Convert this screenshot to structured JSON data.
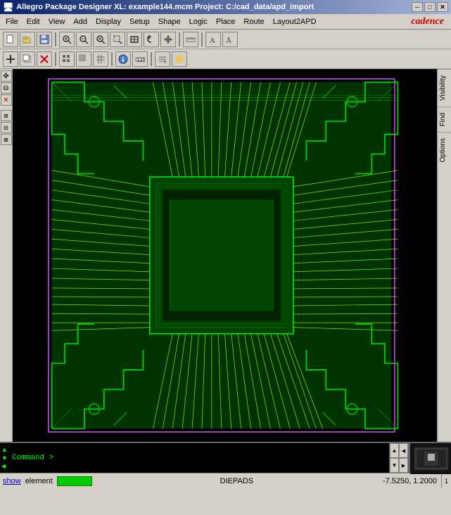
{
  "titleBar": {
    "title": "Allegro Package Designer XL: example144.mcm  Project: C:/cad_data/apd_import",
    "minBtn": "─",
    "maxBtn": "□",
    "closeBtn": "✕"
  },
  "menuBar": {
    "items": [
      "File",
      "Edit",
      "View",
      "Add",
      "Display",
      "Setup",
      "Shape",
      "Logic",
      "Place",
      "Route",
      "Layout2APD"
    ],
    "logo": "cadence"
  },
  "toolbar1": {
    "buttons": [
      {
        "name": "new",
        "icon": "📄"
      },
      {
        "name": "open",
        "icon": "📂"
      },
      {
        "name": "save",
        "icon": "💾"
      },
      {
        "name": "sep1",
        "sep": true
      },
      {
        "name": "zoom-in-center",
        "icon": "⊕"
      },
      {
        "name": "zoom-out",
        "icon": "🔍"
      },
      {
        "name": "zoom-in",
        "icon": "🔎"
      },
      {
        "name": "zoom-area",
        "icon": "🔍"
      },
      {
        "name": "zoom-fit",
        "icon": "↔"
      },
      {
        "name": "zoom-prev",
        "icon": "↺"
      },
      {
        "name": "pan",
        "icon": "✋"
      },
      {
        "name": "sep2",
        "sep": true
      },
      {
        "name": "ruler",
        "icon": "📏"
      },
      {
        "name": "sep3",
        "sep": true
      },
      {
        "name": "text1",
        "icon": "A"
      },
      {
        "name": "text2",
        "icon": "Ā"
      }
    ]
  },
  "toolbar2": {
    "buttons": [
      {
        "name": "select",
        "icon": "✜"
      },
      {
        "name": "copy",
        "icon": "⧉"
      },
      {
        "name": "delete",
        "icon": "✕"
      },
      {
        "name": "sep1",
        "sep": true
      },
      {
        "name": "grid1",
        "icon": "⊞"
      },
      {
        "name": "grid2",
        "icon": "⊟"
      },
      {
        "name": "grid3",
        "icon": "⊠"
      },
      {
        "name": "sep2",
        "sep": true
      },
      {
        "name": "info",
        "icon": "ℹ"
      },
      {
        "name": "measure",
        "icon": "⟺"
      },
      {
        "name": "sep3",
        "sep": true
      },
      {
        "name": "prop1",
        "icon": "✏"
      },
      {
        "name": "sun",
        "icon": "☀"
      }
    ]
  },
  "rightPanel": {
    "tabs": [
      "Visibility",
      "Find",
      "Options"
    ]
  },
  "commandArea": {
    "prompt": "Command >",
    "placeholder": ""
  },
  "statusBar": {
    "showLabel": "show",
    "elementLabel": "element",
    "diepads": "DIEPADS",
    "coords": "-7.5250, 1.2000",
    "indicator": "1"
  }
}
